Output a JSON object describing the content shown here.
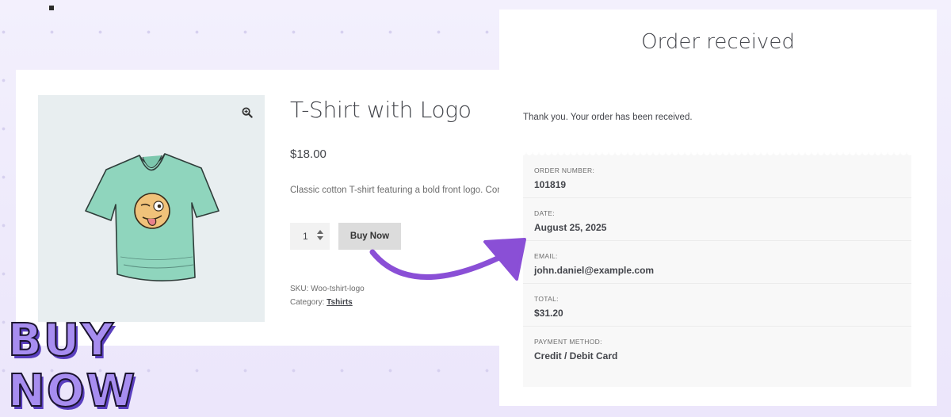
{
  "product": {
    "title": "T-Shirt with Logo",
    "price": "$18.00",
    "description": "Classic cotton T-shirt featuring a bold front logo. Com",
    "quantity": "1",
    "buy_button_label": "Buy Now",
    "sku_label": "SKU: ",
    "sku_value": "Woo-tshirt-logo",
    "category_label": "Category: ",
    "category_value": "Tshirts",
    "icons": {
      "zoom": "zoom-in-icon",
      "image": "tshirt-logo-image"
    }
  },
  "order": {
    "title": "Order received",
    "thank_you": "Thank you. Your order has been received.",
    "fields": [
      {
        "label": "ORDER NUMBER:",
        "value": "101819"
      },
      {
        "label": "DATE:",
        "value": "August 25, 2025"
      },
      {
        "label": "EMAIL:",
        "value": "john.daniel@example.com"
      },
      {
        "label": "TOTAL:",
        "value": "$31.20"
      },
      {
        "label": "PAYMENT METHOD:",
        "value": "Credit / Debit Card"
      }
    ]
  },
  "promo": {
    "line1": "BUY",
    "line2": "NOW"
  },
  "colors": {
    "arrow": "#8a4fd6",
    "promo_fill": "#a78df0",
    "background": "#efebfc",
    "text_main": "#43454b"
  }
}
